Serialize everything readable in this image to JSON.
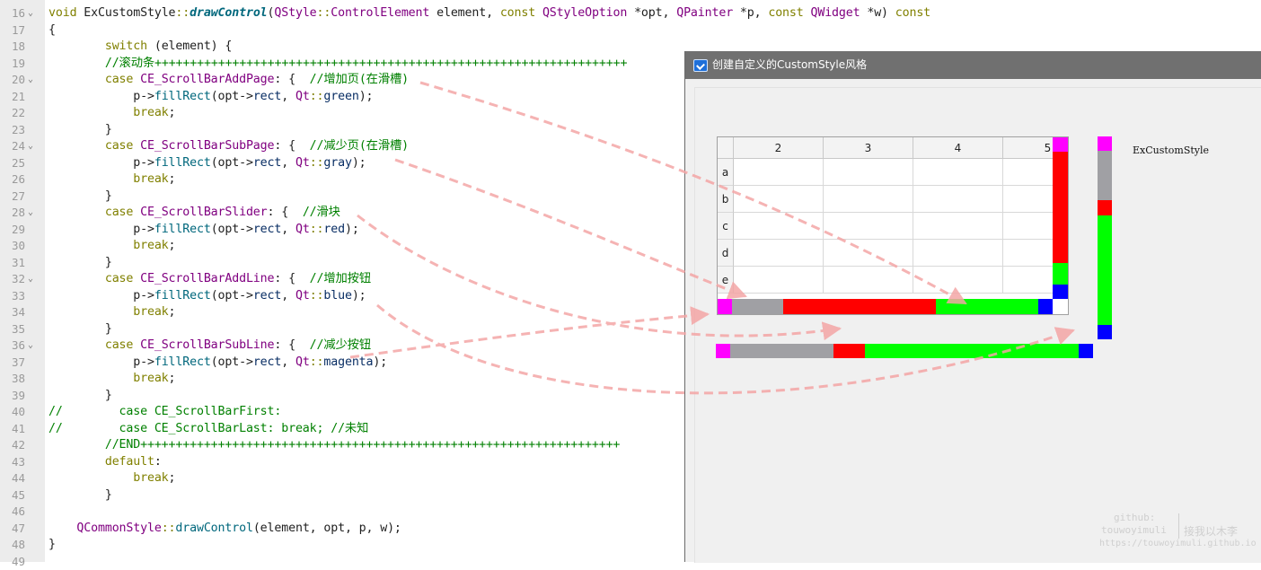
{
  "editor": {
    "lines": [
      {
        "num": "16",
        "fold": true,
        "tokens": [
          [
            "kw",
            "void "
          ],
          [
            "pl",
            "ExCustomStyle"
          ],
          [
            "kw",
            "::"
          ],
          [
            "fn",
            "drawControl"
          ],
          [
            "pl",
            "("
          ],
          [
            "cls",
            "QStyle"
          ],
          [
            "kw",
            "::"
          ],
          [
            "cls",
            "ControlElement"
          ],
          [
            "pl",
            " element, "
          ],
          [
            "kw",
            "const "
          ],
          [
            "cls",
            "QStyleOption"
          ],
          [
            "pl",
            " *opt, "
          ],
          [
            "cls",
            "QPainter"
          ],
          [
            "pl",
            " *p, "
          ],
          [
            "kw",
            "const "
          ],
          [
            "cls",
            "QWidget"
          ],
          [
            "pl",
            " *w) "
          ],
          [
            "kw",
            "const"
          ]
        ]
      },
      {
        "num": "17",
        "fold": false,
        "tokens": [
          [
            "pl",
            "{"
          ]
        ]
      },
      {
        "num": "18",
        "fold": false,
        "tokens": [
          [
            "pl",
            "        "
          ],
          [
            "kw",
            "switch"
          ],
          [
            "pl",
            " (element) {"
          ]
        ]
      },
      {
        "num": "19",
        "fold": false,
        "tokens": [
          [
            "cm",
            "        //滚动条+++++++++++++++++++++++++++++++++++++++++++++++++++++++++++++++++++"
          ]
        ]
      },
      {
        "num": "20",
        "fold": true,
        "tokens": [
          [
            "pl",
            "        "
          ],
          [
            "kw",
            "case "
          ],
          [
            "en",
            "CE_ScrollBarAddPage"
          ],
          [
            "pl",
            ": {  "
          ],
          [
            "cm",
            "//增加页(在滑槽)"
          ]
        ]
      },
      {
        "num": "21",
        "fold": false,
        "tokens": [
          [
            "pl",
            "            p->"
          ],
          [
            "fn2",
            "fillRect"
          ],
          [
            "pl",
            "(opt->"
          ],
          [
            "arg",
            "rect"
          ],
          [
            "pl",
            ", "
          ],
          [
            "cls",
            "Qt"
          ],
          [
            "kw",
            "::"
          ],
          [
            "arg",
            "green"
          ],
          [
            "pl",
            ");"
          ]
        ]
      },
      {
        "num": "22",
        "fold": false,
        "tokens": [
          [
            "pl",
            "            "
          ],
          [
            "kw",
            "break"
          ],
          [
            "pl",
            ";"
          ]
        ]
      },
      {
        "num": "23",
        "fold": false,
        "tokens": [
          [
            "pl",
            "        }"
          ]
        ]
      },
      {
        "num": "24",
        "fold": true,
        "tokens": [
          [
            "pl",
            "        "
          ],
          [
            "kw",
            "case "
          ],
          [
            "en",
            "CE_ScrollBarSubPage"
          ],
          [
            "pl",
            ": {  "
          ],
          [
            "cm",
            "//减少页(在滑槽)"
          ]
        ]
      },
      {
        "num": "25",
        "fold": false,
        "tokens": [
          [
            "pl",
            "            p->"
          ],
          [
            "fn2",
            "fillRect"
          ],
          [
            "pl",
            "(opt->"
          ],
          [
            "arg",
            "rect"
          ],
          [
            "pl",
            ", "
          ],
          [
            "cls",
            "Qt"
          ],
          [
            "kw",
            "::"
          ],
          [
            "arg",
            "gray"
          ],
          [
            "pl",
            ");"
          ]
        ]
      },
      {
        "num": "26",
        "fold": false,
        "tokens": [
          [
            "pl",
            "            "
          ],
          [
            "kw",
            "break"
          ],
          [
            "pl",
            ";"
          ]
        ]
      },
      {
        "num": "27",
        "fold": false,
        "tokens": [
          [
            "pl",
            "        }"
          ]
        ]
      },
      {
        "num": "28",
        "fold": true,
        "tokens": [
          [
            "pl",
            "        "
          ],
          [
            "kw",
            "case "
          ],
          [
            "en",
            "CE_ScrollBarSlider"
          ],
          [
            "pl",
            ": {  "
          ],
          [
            "cm",
            "//滑块"
          ]
        ]
      },
      {
        "num": "29",
        "fold": false,
        "tokens": [
          [
            "pl",
            "            p->"
          ],
          [
            "fn2",
            "fillRect"
          ],
          [
            "pl",
            "(opt->"
          ],
          [
            "arg",
            "rect"
          ],
          [
            "pl",
            ", "
          ],
          [
            "cls",
            "Qt"
          ],
          [
            "kw",
            "::"
          ],
          [
            "arg",
            "red"
          ],
          [
            "pl",
            ");"
          ]
        ]
      },
      {
        "num": "30",
        "fold": false,
        "tokens": [
          [
            "pl",
            "            "
          ],
          [
            "kw",
            "break"
          ],
          [
            "pl",
            ";"
          ]
        ]
      },
      {
        "num": "31",
        "fold": false,
        "tokens": [
          [
            "pl",
            "        }"
          ]
        ]
      },
      {
        "num": "32",
        "fold": true,
        "tokens": [
          [
            "pl",
            "        "
          ],
          [
            "kw",
            "case "
          ],
          [
            "en",
            "CE_ScrollBarAddLine"
          ],
          [
            "pl",
            ": {  "
          ],
          [
            "cm",
            "//增加按钮"
          ]
        ]
      },
      {
        "num": "33",
        "fold": false,
        "tokens": [
          [
            "pl",
            "            p->"
          ],
          [
            "fn2",
            "fillRect"
          ],
          [
            "pl",
            "(opt->"
          ],
          [
            "arg",
            "rect"
          ],
          [
            "pl",
            ", "
          ],
          [
            "cls",
            "Qt"
          ],
          [
            "kw",
            "::"
          ],
          [
            "arg",
            "blue"
          ],
          [
            "pl",
            ");"
          ]
        ]
      },
      {
        "num": "34",
        "fold": false,
        "tokens": [
          [
            "pl",
            "            "
          ],
          [
            "kw",
            "break"
          ],
          [
            "pl",
            ";"
          ]
        ]
      },
      {
        "num": "35",
        "fold": false,
        "tokens": [
          [
            "pl",
            "        }"
          ]
        ]
      },
      {
        "num": "36",
        "fold": true,
        "tokens": [
          [
            "pl",
            "        "
          ],
          [
            "kw",
            "case "
          ],
          [
            "en",
            "CE_ScrollBarSubLine"
          ],
          [
            "pl",
            ": {  "
          ],
          [
            "cm",
            "//减少按钮"
          ]
        ]
      },
      {
        "num": "37",
        "fold": false,
        "tokens": [
          [
            "pl",
            "            p->"
          ],
          [
            "fn2",
            "fillRect"
          ],
          [
            "pl",
            "(opt->"
          ],
          [
            "arg",
            "rect"
          ],
          [
            "pl",
            ", "
          ],
          [
            "cls",
            "Qt"
          ],
          [
            "kw",
            "::"
          ],
          [
            "arg",
            "magenta"
          ],
          [
            "pl",
            ");"
          ]
        ]
      },
      {
        "num": "38",
        "fold": false,
        "tokens": [
          [
            "pl",
            "            "
          ],
          [
            "kw",
            "break"
          ],
          [
            "pl",
            ";"
          ]
        ]
      },
      {
        "num": "39",
        "fold": false,
        "tokens": [
          [
            "pl",
            "        }"
          ]
        ]
      },
      {
        "num": "40",
        "fold": false,
        "tokens": [
          [
            "cm",
            "//        case CE_ScrollBarFirst:"
          ]
        ]
      },
      {
        "num": "41",
        "fold": false,
        "tokens": [
          [
            "cm",
            "//        case CE_ScrollBarLast: break; //未知"
          ]
        ]
      },
      {
        "num": "42",
        "fold": false,
        "tokens": [
          [
            "cm",
            "        //END++++++++++++++++++++++++++++++++++++++++++++++++++++++++++++++++++++"
          ]
        ]
      },
      {
        "num": "43",
        "fold": false,
        "tokens": [
          [
            "pl",
            "        "
          ],
          [
            "kw",
            "default"
          ],
          [
            "pl",
            ":"
          ]
        ]
      },
      {
        "num": "44",
        "fold": false,
        "tokens": [
          [
            "pl",
            "            "
          ],
          [
            "kw",
            "break"
          ],
          [
            "pl",
            ";"
          ]
        ]
      },
      {
        "num": "45",
        "fold": false,
        "tokens": [
          [
            "pl",
            "        }"
          ]
        ]
      },
      {
        "num": "46",
        "fold": false,
        "tokens": []
      },
      {
        "num": "47",
        "fold": false,
        "tokens": [
          [
            "pl",
            "    "
          ],
          [
            "cls",
            "QCommonStyle"
          ],
          [
            "kw",
            "::"
          ],
          [
            "fn2",
            "drawControl"
          ],
          [
            "pl",
            "(element, opt, p, w);"
          ]
        ]
      },
      {
        "num": "48",
        "fold": false,
        "tokens": [
          [
            "pl",
            "}"
          ]
        ]
      },
      {
        "num": "49",
        "fold": false,
        "tokens": []
      }
    ]
  },
  "dialog": {
    "title": "创建自定义的CustomStyle风格",
    "style_label": "ExCustomStyle",
    "table": {
      "columns": [
        "2",
        "3",
        "4",
        "5"
      ],
      "rows": [
        "a",
        "b",
        "c",
        "d",
        "e"
      ]
    }
  },
  "scrollbar_colors": {
    "sub_line": "#ff00ff",
    "sub_page": "#a0a0a4",
    "slider": "#ff0000",
    "add_page": "#00ff00",
    "add_line": "#0000ff"
  },
  "watermark": {
    "line1": "github:",
    "line2": "touwoyimuli",
    "line3": "接我以木李",
    "line4": "https://touwoyimuli.github.io"
  }
}
